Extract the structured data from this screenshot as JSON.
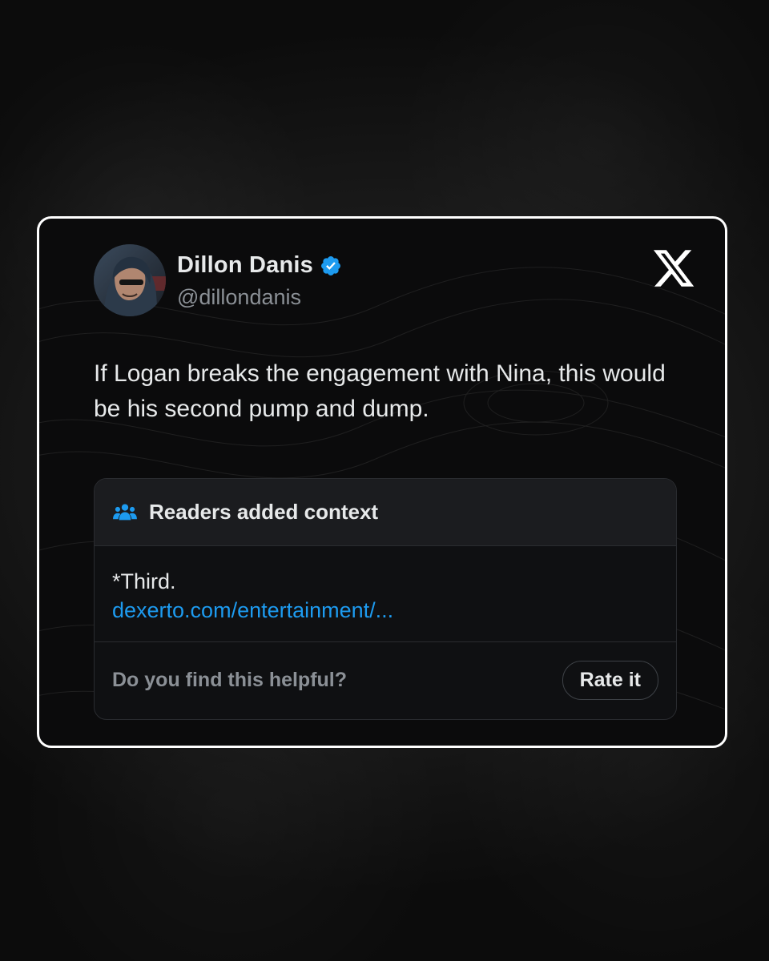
{
  "tweet": {
    "author_name": "Dillon Danis",
    "author_handle": "@dillondanis",
    "text": "If Logan breaks the engagement with Nina, this would be his second pump and dump."
  },
  "community_note": {
    "header": "Readers added context",
    "text": "*Third.",
    "link": "dexerto.com/entertainment/...",
    "helpful_prompt": "Do you find this helpful?",
    "rate_label": "Rate it"
  },
  "colors": {
    "accent": "#1d9bf0",
    "card_border": "#ffffff",
    "card_background": "#0b0b0c",
    "text_primary": "#e7e9ea",
    "text_secondary": "#8b9096"
  },
  "icons": {
    "verified": "verified-badge-icon",
    "brand": "x-logo-icon",
    "readers": "readers-group-icon"
  }
}
